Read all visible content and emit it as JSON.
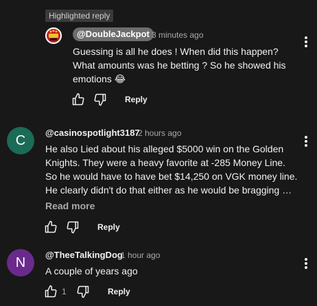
{
  "highlighted_label": "Highlighted reply",
  "reply": {
    "author": "@DoubleJackpot",
    "time": "3 minutes ago",
    "lines": [
      "Guessing is all he does !   When did this happen?",
      "What amounts was he betting ?  So he showed his",
      "emotions 😂"
    ],
    "reply_label": "Reply"
  },
  "comments": [
    {
      "avatar_letter": "C",
      "avatar_color": "#1a6b57",
      "author": "@casinospotlight3187",
      "time": "2 hours ago",
      "lines": [
        "He also Lied about his alleged $5000 win on the Golden",
        "Knights. They were a heavy favorite at -285 Money Line.",
        "So he would have to have bet $14,250 on VGK money line.",
        "He clearly didn't do that either as he would be bragging …"
      ],
      "read_more": "Read more",
      "reply_label": "Reply"
    },
    {
      "avatar_letter": "N",
      "avatar_color": "#6a2a8c",
      "author": "@TheeTalkingDog",
      "time": "1 hour ago",
      "lines": [
        "A couple of years ago"
      ],
      "like_count": "1",
      "reply_label": "Reply"
    }
  ]
}
